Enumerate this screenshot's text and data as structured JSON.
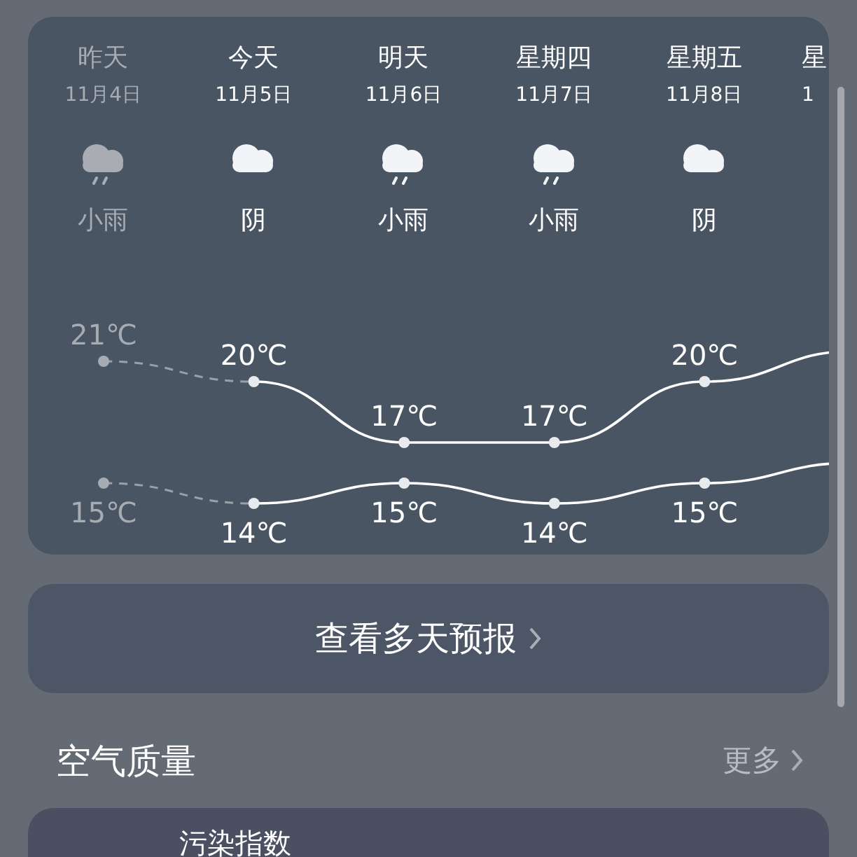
{
  "forecast": {
    "days": [
      {
        "day": "昨天",
        "date": "11月4日",
        "kind": "rain",
        "condition": "小雨",
        "high": "21℃",
        "low": "15℃",
        "dimmed": true
      },
      {
        "day": "今天",
        "date": "11月5日",
        "kind": "cloudy",
        "condition": "阴",
        "high": "20℃",
        "low": "14℃",
        "dimmed": false
      },
      {
        "day": "明天",
        "date": "11月6日",
        "kind": "rain",
        "condition": "小雨",
        "high": "17℃",
        "low": "15℃",
        "dimmed": false
      },
      {
        "day": "星期四",
        "date": "11月7日",
        "kind": "rain",
        "condition": "小雨",
        "high": "17℃",
        "low": "14℃",
        "dimmed": false
      },
      {
        "day": "星期五",
        "date": "11月8日",
        "kind": "cloudy",
        "condition": "阴",
        "high": "20℃",
        "low": "15℃",
        "dimmed": false
      },
      {
        "day": "星",
        "date": "1"
      }
    ]
  },
  "more_days_button": {
    "label": "查看多天预报"
  },
  "air_quality": {
    "title": "空气质量",
    "more": "更多",
    "card_title": "污染指数"
  }
}
